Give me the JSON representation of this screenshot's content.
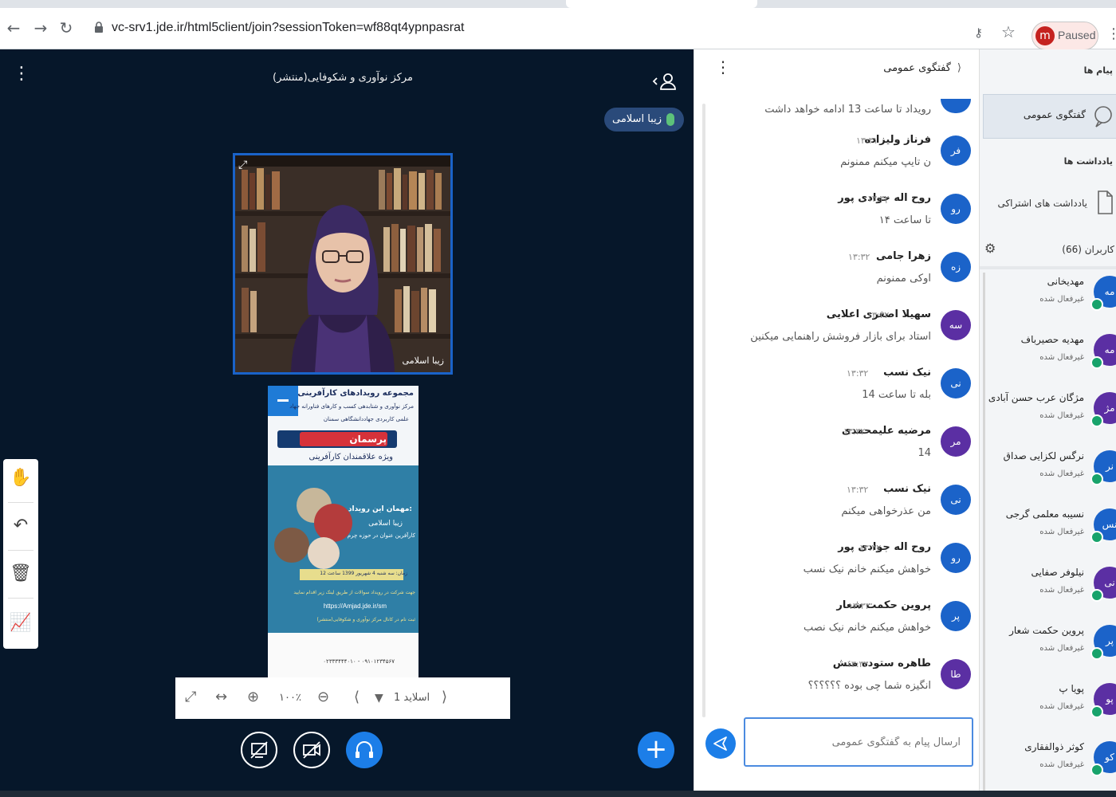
{
  "browser": {
    "url": "vc-srv1.jde.ir/html5client/join?sessionToken=wf88qt4ypnpasrat",
    "profile_initial": "m",
    "profile_status": "Paused"
  },
  "meeting": {
    "title": "مرکز نوآوری و شکوفایی(منتشر)",
    "talker": "زیبا اسلامی",
    "webcam_name": "زیبا اسلامی"
  },
  "slide_controls": {
    "slide_label": "اسلاید 1",
    "zoom": "۱۰۰٪"
  },
  "slide": {
    "header": "مجموعه رویدادهای کارآفرینی",
    "sub1": "مرکز نوآوری و شتابدهی کسب و کارهای فناورانه جهاد",
    "sub2": "علمی کاربردی جهاددانشگاهی سمنان",
    "banner": "پرسمان",
    "audience": "ویژه علاقمندان کارآفرینی",
    "guest_label": "مهمان این رویداد:",
    "guest_name": "زیبا اسلامی",
    "guest_role": "کارآفرین عنوان در حوزه چرم",
    "date_line": "زمان: سه شنبه 4 شهریور 1399 ساعت 12",
    "register_line": "جهت شرکت در رویداد سوالات از طریق لینک زیر اقدام نمایید",
    "link": "https://Amjad.jde.ir/sm",
    "footer_line": "ثبت نام در کانال مرکز نوآوری و شکوفایی(منتشر)",
    "phone": "۰۲۳۳۳۴۴۴۰۱۰ - ۰۹۱۰۱۲۳۴۵۶۷"
  },
  "chat": {
    "title": "گفتگوی عمومی",
    "first_msg": "رویداد تا ساعت 13 ادامه خواهد داشت",
    "input_placeholder": "ارسال پیام به گفتگوی عمومی",
    "messages": [
      {
        "avatar": "فر",
        "name": "فرناز ولیزاده",
        "time": "۱۳:۳۱",
        "text": "ن تایپ میکنم ممنونم",
        "color": "#1b63c9"
      },
      {
        "avatar": "رو",
        "name": "روح اله جوادی پور",
        "time": "۱۳:۳۲",
        "text": "تا ساعت ۱۴",
        "color": "#1b63c9"
      },
      {
        "avatar": "زه",
        "name": "زهرا جامی",
        "time": "۱۳:۳۲",
        "text": "اوکی ممنونم",
        "color": "#1b63c9"
      },
      {
        "avatar": "سه",
        "name": "سهیلا اصغری اعلایی",
        "time": "۱۳:۳۲",
        "text": "استاد برای بازار فروشش راهنمایی میکنین",
        "color": "#5b2fa3"
      },
      {
        "avatar": "نی",
        "name": "نیک نسب",
        "time": "۱۳:۳۲",
        "text": "بله تا ساعت 14",
        "color": "#1b63c9"
      },
      {
        "avatar": "مر",
        "name": "مرضیه علیمحمدی",
        "time": "۱۳:۳۲",
        "text": "14",
        "color": "#5b2fa3"
      },
      {
        "avatar": "نی",
        "name": "نیک نسب",
        "time": "۱۳:۳۲",
        "text": "من عذرخواهی میکنم",
        "color": "#1b63c9"
      },
      {
        "avatar": "رو",
        "name": "روح اله جوادی پور",
        "time": "۱۳:۳۲",
        "text": "خواهش میکنم خانم نیک نسب",
        "color": "#1b63c9"
      },
      {
        "avatar": "پر",
        "name": "پروین حکمت شعار",
        "time": "۱۳:۳۳",
        "text": "خواهش میکنم خانم نیک نصب",
        "color": "#1b63c9"
      },
      {
        "avatar": "طا",
        "name": "طاهره ستوده منش",
        "time": "۱۳:۳۳",
        "text": "انگیزه شما چی بوده ؟؟؟؟؟؟",
        "color": "#5b2fa3"
      }
    ]
  },
  "users_panel": {
    "messages_header": "پیام ها",
    "public_chat": "گفتگوی عمومی",
    "notes_header": "یادداشت ها",
    "shared_notes": "یادداشت های اشتراکی",
    "users_count": "کاربران (66)",
    "users": [
      {
        "avatar": "مه",
        "name": "مهدیخانی",
        "status": "غیرفعال شده",
        "color": "#1b63c9"
      },
      {
        "avatar": "مه",
        "name": "مهدیه حصیرباف",
        "status": "غیرفعال شده",
        "color": "#5b2fa3"
      },
      {
        "avatar": "مژ",
        "name": "مژگان عرب حسن آبادی",
        "status": "غیرفعال شده",
        "color": "#5b2fa3"
      },
      {
        "avatar": "نر",
        "name": "نرگس لکزایی صداق",
        "status": "غیرفعال شده",
        "color": "#1b63c9"
      },
      {
        "avatar": "نس",
        "name": "نسیبه معلمی گرجی",
        "status": "غیرفعال شده",
        "color": "#1b63c9"
      },
      {
        "avatar": "نی",
        "name": "نیلوفر صفایی",
        "status": "غیرفعال شده",
        "color": "#5b2fa3"
      },
      {
        "avatar": "پر",
        "name": "پروین حکمت شعار",
        "status": "غیرفعال شده",
        "color": "#1b63c9"
      },
      {
        "avatar": "پو",
        "name": "پویا پ",
        "status": "غیرفعال شده",
        "color": "#5b2fa3"
      },
      {
        "avatar": "کو",
        "name": "کوثر ذوالفقاری",
        "status": "غیرفعال شده",
        "color": "#1b63c9"
      }
    ]
  },
  "colors": {
    "stage_bg": "#06172a",
    "accent": "#1c7ee8",
    "avatar_blue": "#1b63c9",
    "avatar_purple": "#5b2fa3"
  }
}
